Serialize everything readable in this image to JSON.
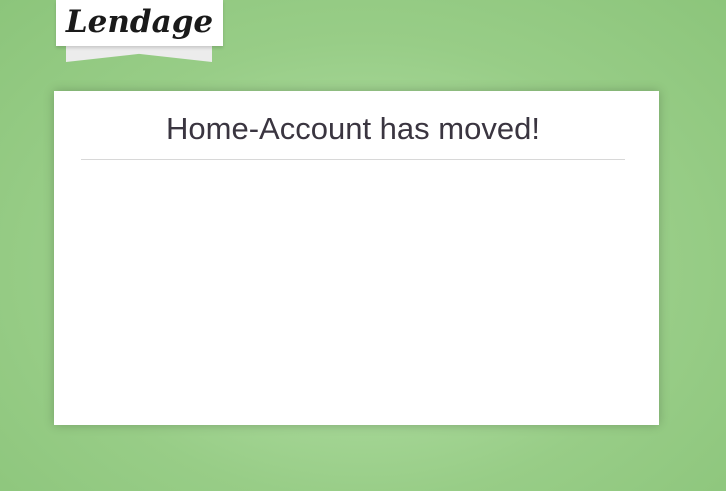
{
  "brand": {
    "logo_text": "Lendage"
  },
  "notice": {
    "title": "Home-Account has moved!"
  },
  "colors": {
    "background": "#a9d99a",
    "card": "#ffffff",
    "title_text": "#3a3540"
  }
}
